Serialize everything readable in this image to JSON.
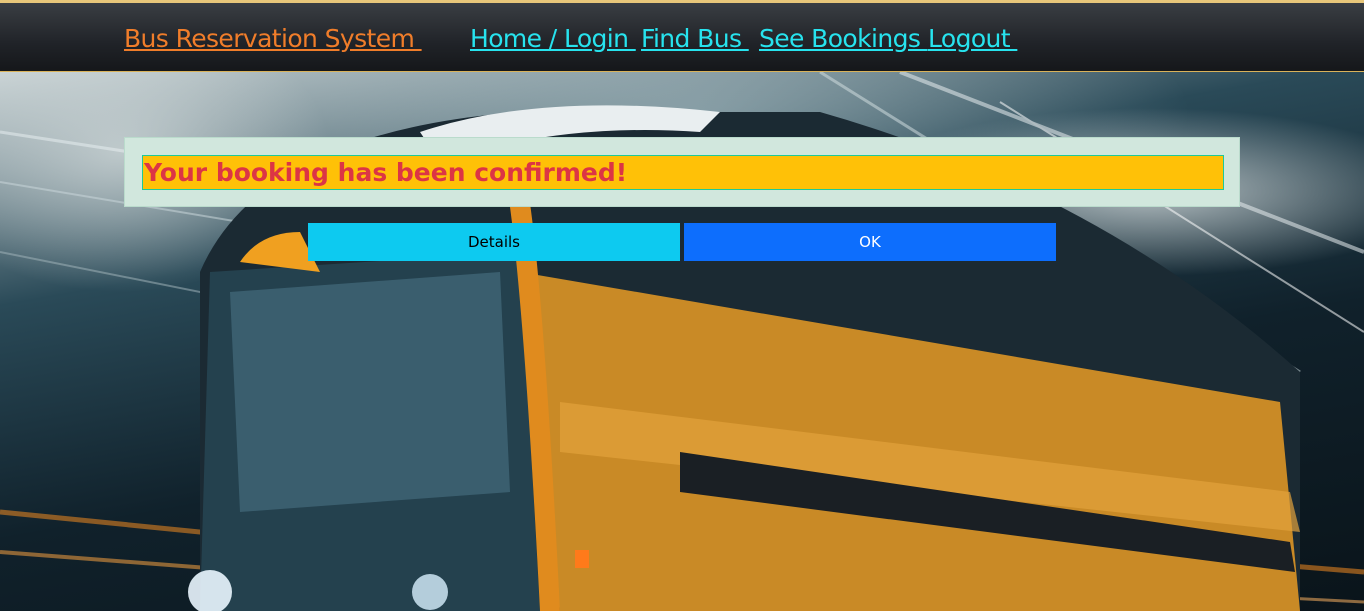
{
  "nav": {
    "brand": "Bus Reservation System ",
    "links": [
      "Home / Login ",
      "Find Bus ",
      "See Bookings ",
      "Logout "
    ]
  },
  "alert": {
    "message": "Your booking has been confirmed!"
  },
  "actions": {
    "details_label": "Details",
    "ok_label": "OK"
  },
  "colors": {
    "brand": "#f07d2a",
    "nav_link": "#27e3ee",
    "alert_bg": "#d1e7dd",
    "message_bg": "#ffc107",
    "message_text": "#dc3545",
    "details_button": "#0dcaf0",
    "ok_button": "#0d6efd"
  }
}
